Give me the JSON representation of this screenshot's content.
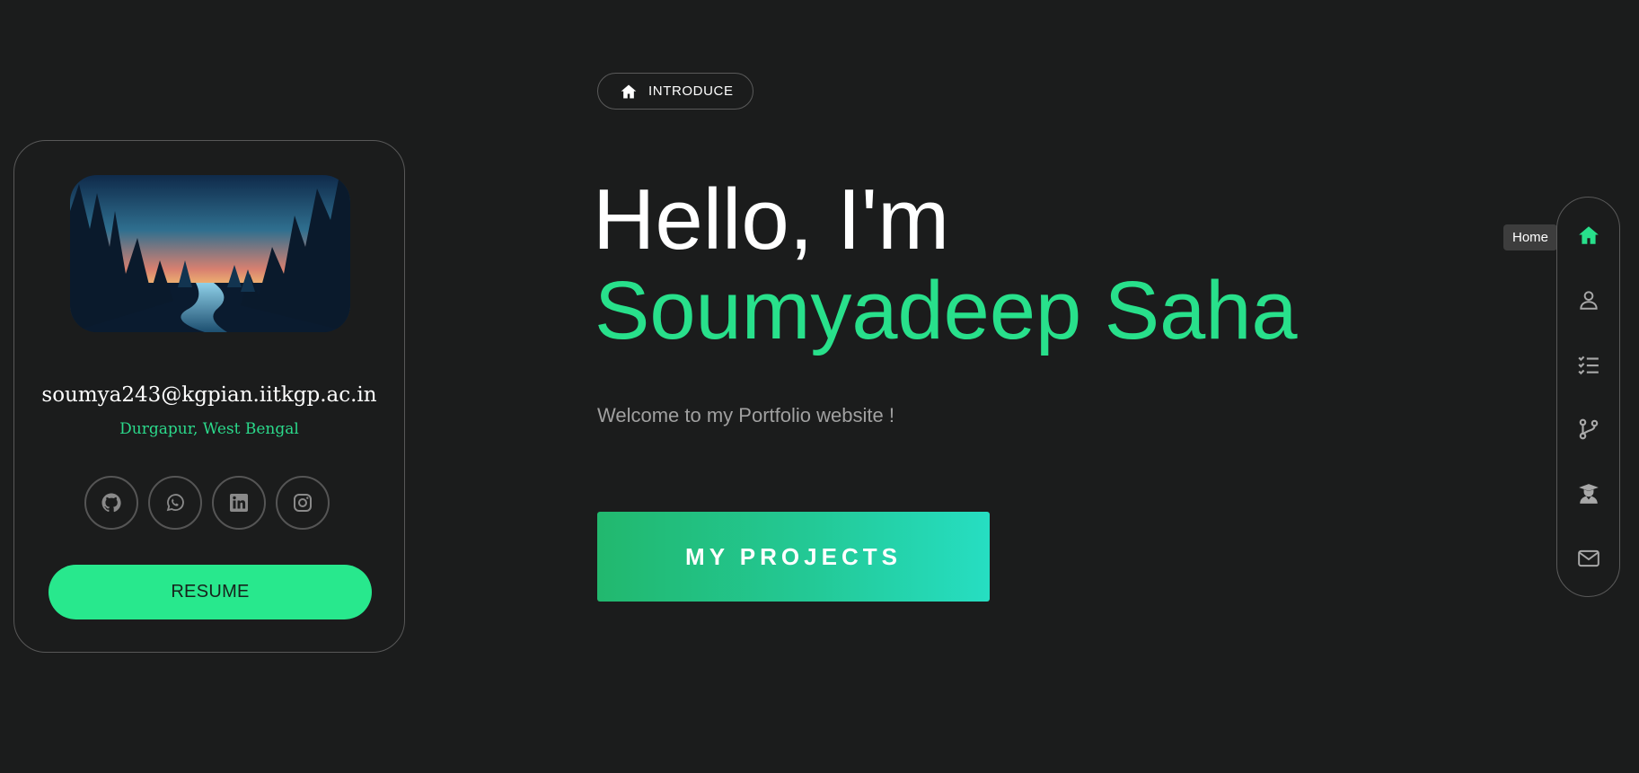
{
  "profile": {
    "email": "soumya243@kgpian.iitkgp.ac.in",
    "location": "Durgapur, West Bengal",
    "socials": [
      {
        "icon": "github-icon"
      },
      {
        "icon": "whatsapp-icon"
      },
      {
        "icon": "linkedin-icon"
      },
      {
        "icon": "instagram-icon"
      }
    ],
    "resume_label": "RESUME"
  },
  "intro": {
    "badge_label": "INTRODUCE",
    "badge_icon": "home-icon",
    "greeting": "Hello, I'm",
    "name": "Soumyadeep Saha",
    "welcome": "Welcome to my Portfolio website !",
    "cta_label": "MY PROJECTS"
  },
  "side_nav": {
    "items": [
      {
        "icon": "home-icon",
        "active": true
      },
      {
        "icon": "user-icon"
      },
      {
        "icon": "checklist-icon"
      },
      {
        "icon": "git-branch-icon"
      },
      {
        "icon": "graduation-icon"
      },
      {
        "icon": "envelope-icon"
      }
    ],
    "tooltip": "Home"
  },
  "colors": {
    "background": "#1b1c1c",
    "accent": "#28e08b",
    "cta_gradient_start": "#22b86e",
    "cta_gradient_end": "#26dec2",
    "muted_text": "#a0a0a0"
  }
}
